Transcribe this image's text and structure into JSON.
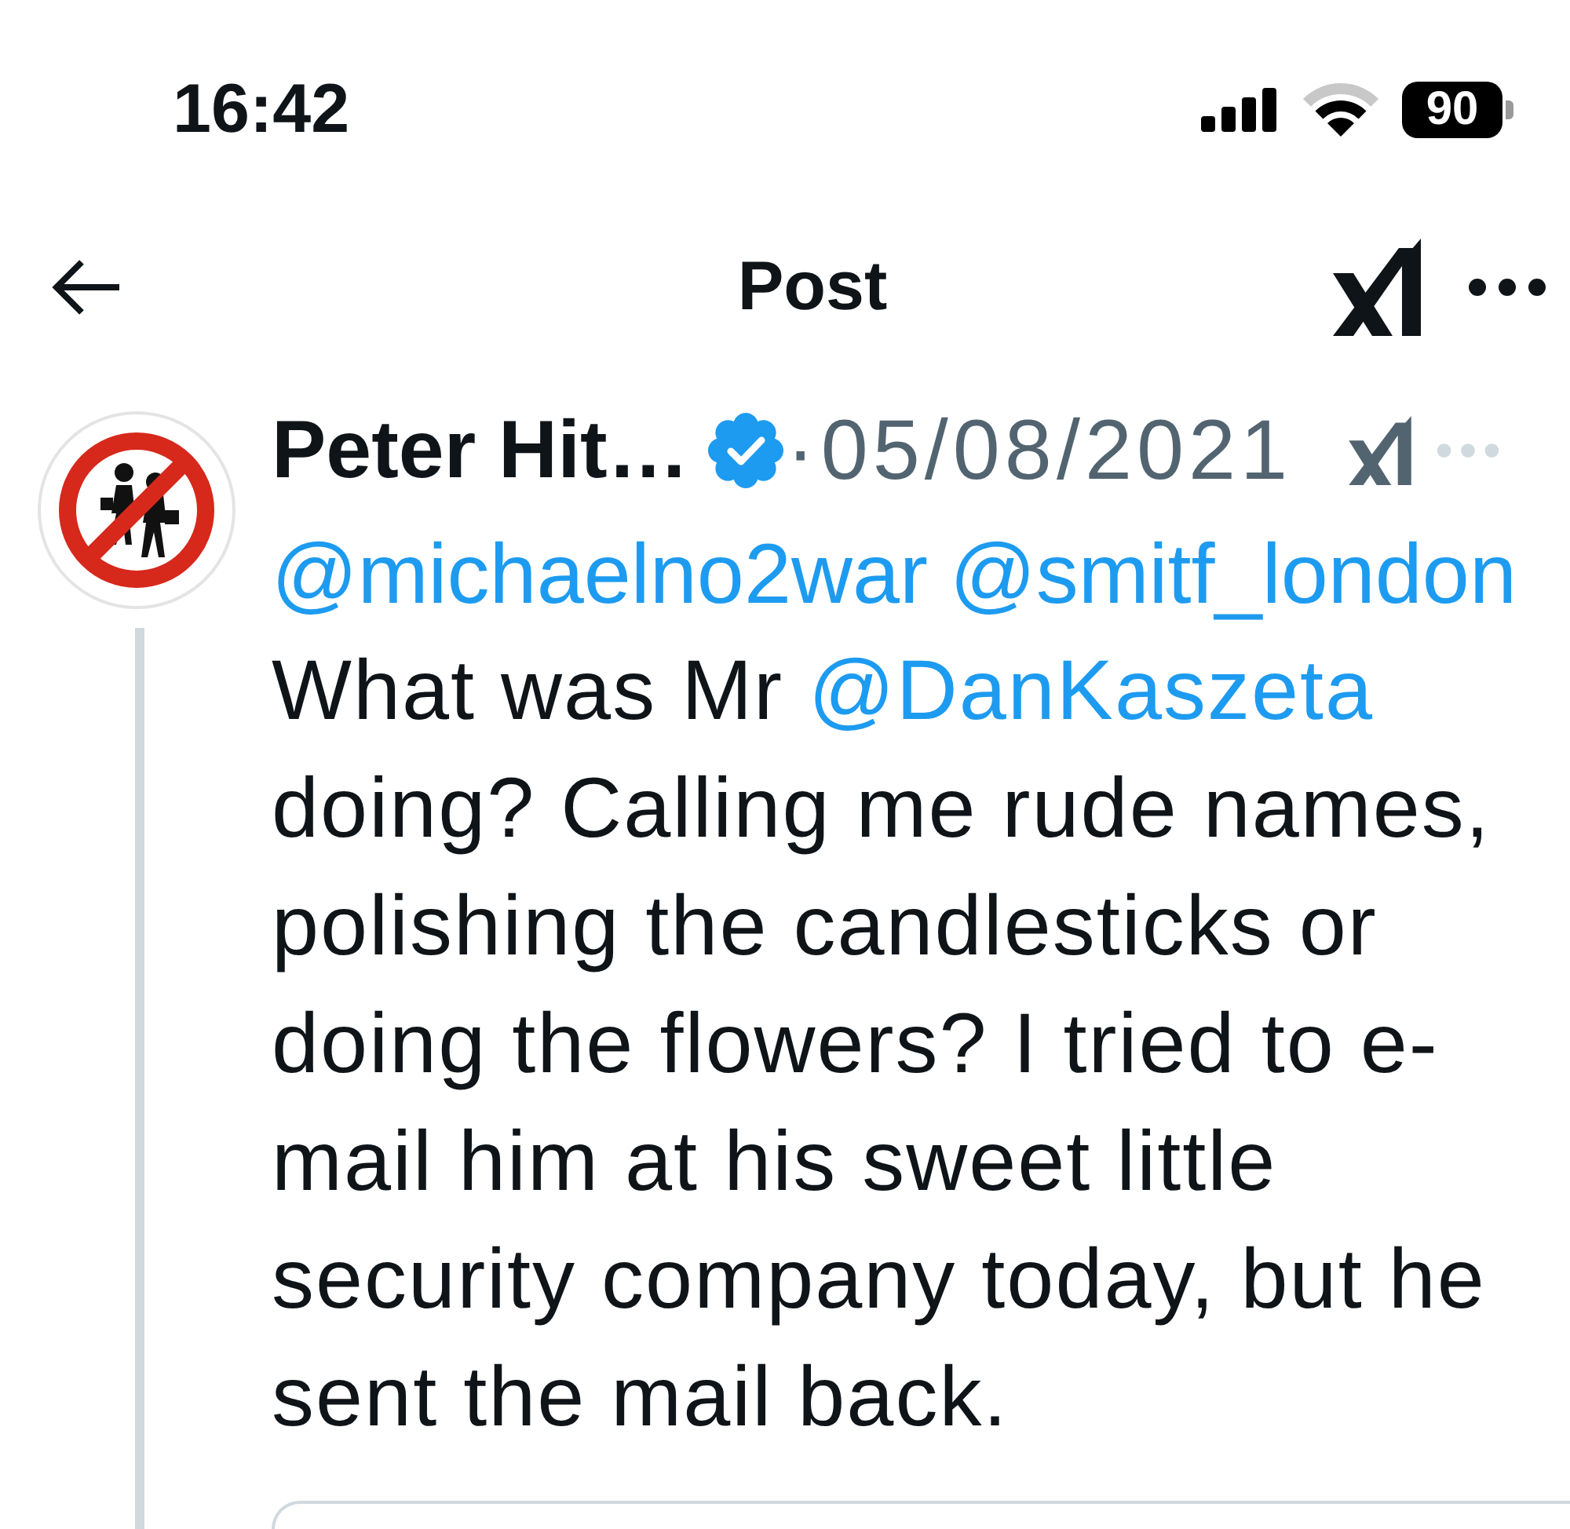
{
  "status_bar": {
    "time": "16:42",
    "battery": "90"
  },
  "header": {
    "title": "Post"
  },
  "post": {
    "author": {
      "name": "Peter Hit…",
      "verified": true
    },
    "separator": "·",
    "date": "05/08/2021",
    "reply_to": [
      "@michaelno2war",
      "@smitf_london"
    ],
    "body": [
      {
        "kind": "text",
        "text": "What was Mr "
      },
      {
        "kind": "mention",
        "text": "@DanKaszeta"
      },
      {
        "kind": "text",
        "text": " doing? Calling me rude names, polishing the candlesticks or doing the flowers? I tried to e-mail him at his sweet little security company today, but he sent the mail back."
      }
    ]
  }
}
